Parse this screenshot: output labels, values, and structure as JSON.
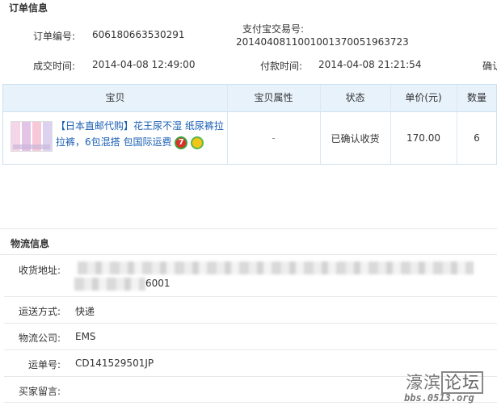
{
  "order": {
    "title": "订单信息",
    "order_no_label": "订单编号:",
    "order_no": "606180663530291",
    "alipay_label": "支付宝交易号:",
    "alipay_no": "2014040811001001370051963723",
    "deal_time_label": "成交时间:",
    "deal_time": "2014-04-08 12:49:00",
    "pay_time_label": "付款时间:",
    "pay_time": "2014-04-08 21:21:54",
    "confirm_cut": "确认"
  },
  "table": {
    "headers": [
      "宝贝",
      "宝贝属性",
      "状态",
      "单价(元)",
      "数量"
    ],
    "row": {
      "name": "【日本直邮代购】花王尿不湿 纸尿裤拉拉裤，6包混搭 包国际运费",
      "attr": "-",
      "status": "已确认收货",
      "price": "170.00",
      "qty": "6",
      "badge_seven": "7"
    }
  },
  "logistics": {
    "title": "物流信息",
    "address_label": "收货地址:",
    "address_tail": "6001",
    "ship_label": "运送方式:",
    "ship_value": "快递",
    "company_label": "物流公司:",
    "company_value": "EMS",
    "waybill_label": "运单号:",
    "waybill_value": "CD141529501JP",
    "note_label": "买家留言:",
    "note_value": ""
  },
  "watermark": {
    "name_part1": "濠滨",
    "name_part2": "论坛",
    "url": "bbs.0513.org"
  }
}
